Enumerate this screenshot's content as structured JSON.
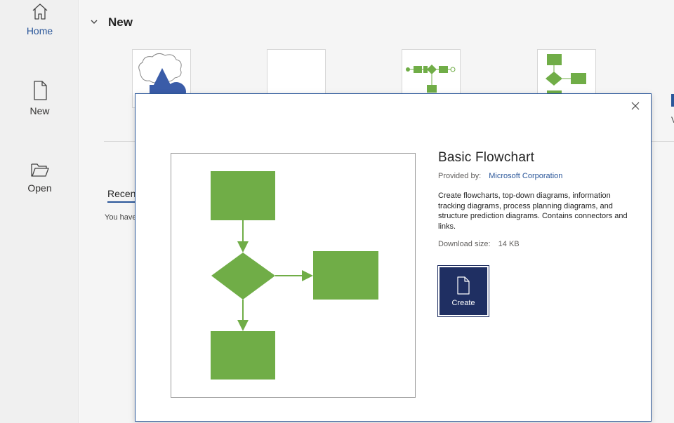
{
  "nav": {
    "items": [
      {
        "label": "Home",
        "icon": "home-icon",
        "active": true
      },
      {
        "label": "New",
        "icon": "new-document-icon",
        "active": false
      },
      {
        "label": "Open",
        "icon": "open-folder-icon",
        "active": false
      }
    ]
  },
  "main": {
    "section_title": "New",
    "recent_tab": "Recent",
    "recent_empty": "You have",
    "edge_text": "V"
  },
  "dialog": {
    "title": "Basic Flowchart",
    "provider_label": "Provided by:",
    "provider_name": "Microsoft Corporation",
    "description": "Create flowcharts, top-down diagrams, information tracking diagrams, process planning diagrams, and structure prediction diagrams. Contains connectors and links.",
    "size_label": "Download size:",
    "size_value": "14 KB",
    "create_label": "Create"
  },
  "colors": {
    "accent": "#2b579a",
    "shape_green": "#70ad47",
    "create_button": "#1f2f62",
    "shape_blue": "#3a5ca8"
  }
}
